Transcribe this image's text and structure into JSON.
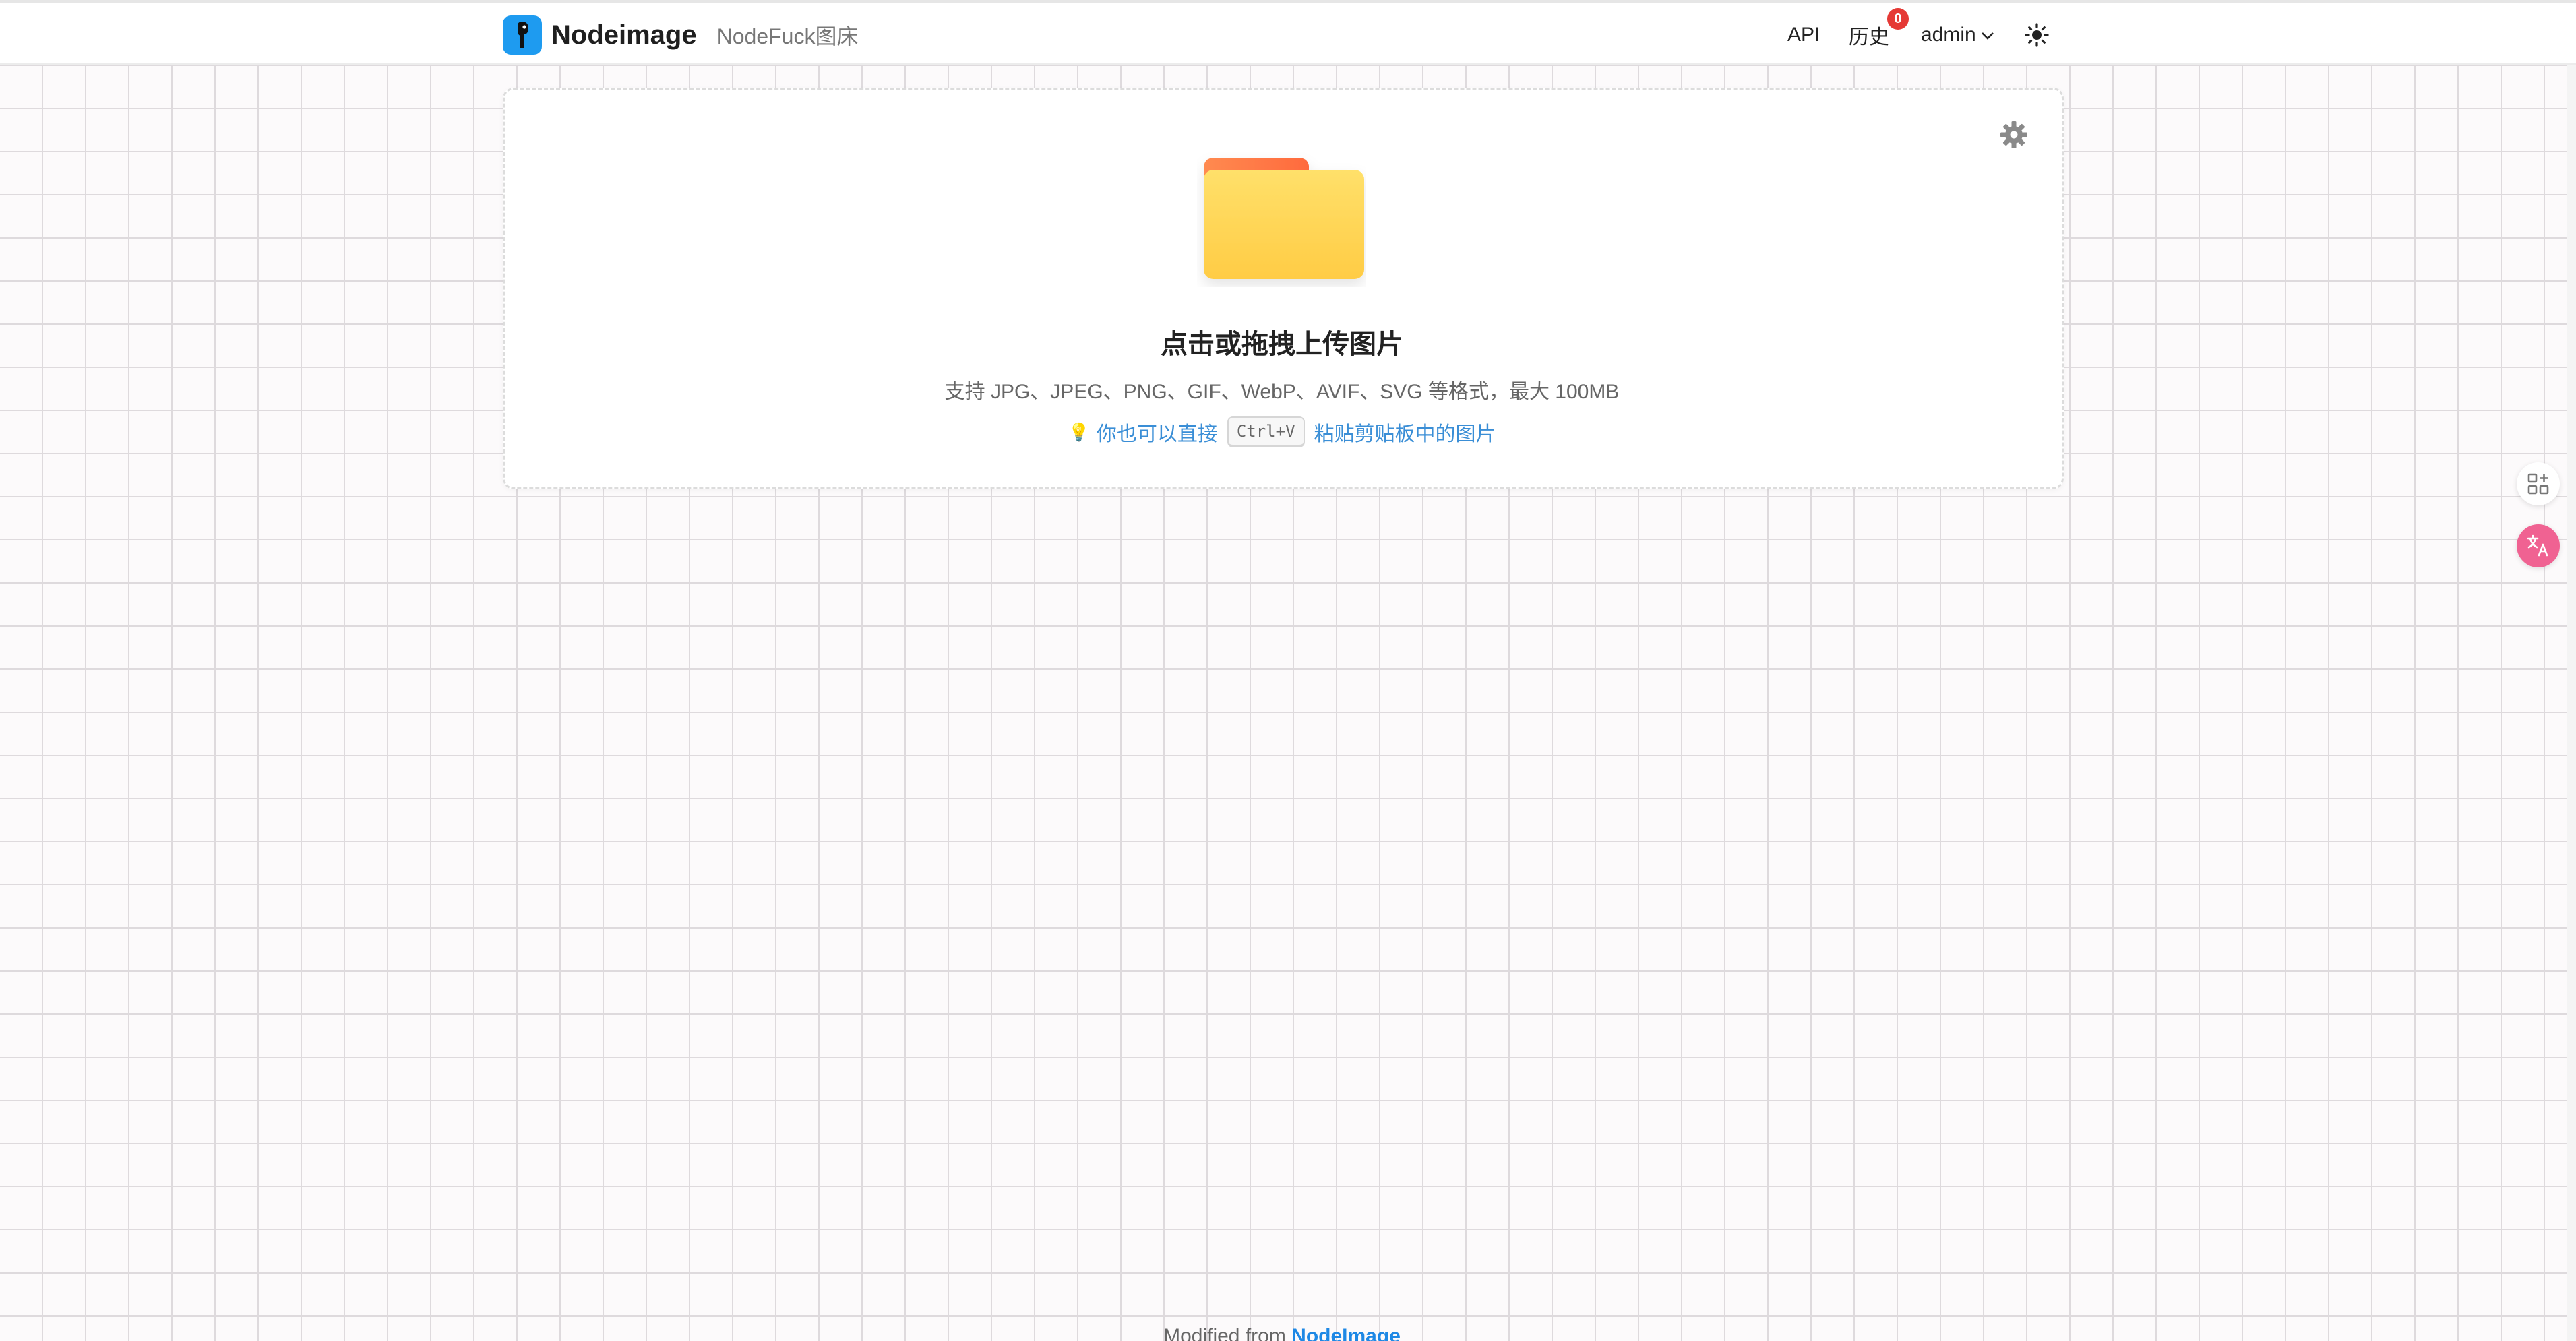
{
  "header": {
    "brand_name": "Nodeimage",
    "brand_subtitle": "NodeFuck图床",
    "nav_api": "API",
    "nav_history": "历史",
    "history_badge": "0",
    "nav_user": "admin",
    "icons": {
      "logo": "nodeimage-logo-icon",
      "user_menu": "chevron-down-icon",
      "theme": "sun-icon"
    }
  },
  "upload": {
    "title": "点击或拖拽上传图片",
    "formats": "支持 JPG、JPEG、PNG、GIF、WebP、AVIF、SVG 等格式，最大 100MB",
    "tip_prefix": "你也可以直接",
    "tip_key": "Ctrl+V",
    "tip_suffix": "粘贴剪贴板中的图片",
    "icons": {
      "folder": "folder-icon",
      "settings": "gear-icon",
      "tip": "lightbulb-icon"
    }
  },
  "side": {
    "icons": [
      "apps-icon",
      "translate-icon"
    ]
  },
  "footer": {
    "prefix": "Modified from",
    "link": "NodeImage"
  },
  "colors": {
    "brand": "#1e9bf0",
    "badge": "#e53935",
    "link": "#3a8ed6",
    "folder_front": "#ffd24f",
    "folder_back": "#ff7a4a"
  }
}
